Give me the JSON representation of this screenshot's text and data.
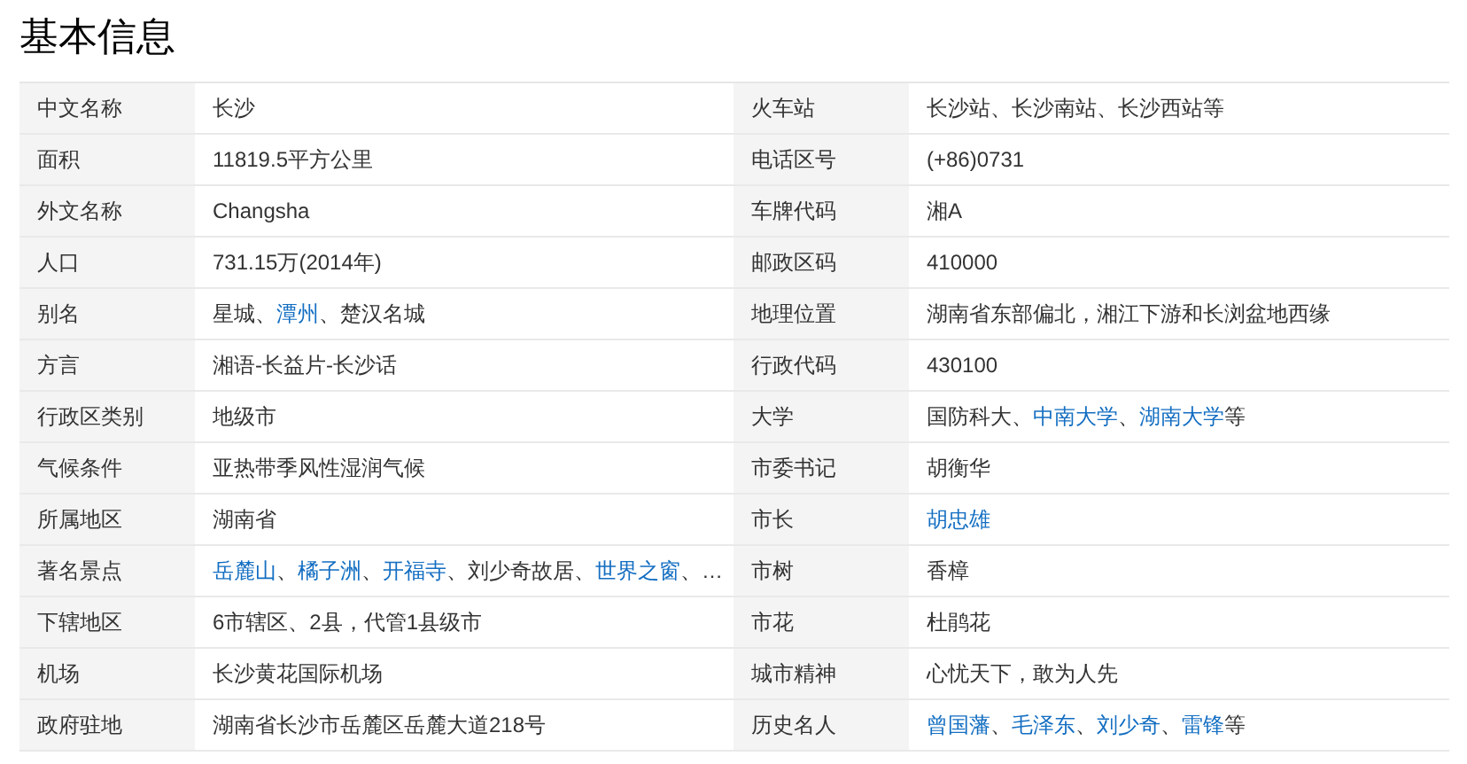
{
  "title": "基本信息",
  "columns": [
    {
      "rows": [
        {
          "label": "中文名称",
          "value": [
            {
              "text": "长沙",
              "link": false
            }
          ]
        },
        {
          "label": "面积",
          "value": [
            {
              "text": "11819.5平方公里",
              "link": false
            }
          ]
        },
        {
          "label": "外文名称",
          "value": [
            {
              "text": "Changsha",
              "link": false
            }
          ]
        },
        {
          "label": "人口",
          "value": [
            {
              "text": "731.15万(2014年)",
              "link": false
            }
          ]
        },
        {
          "label": "别名",
          "value": [
            {
              "text": "星城、",
              "link": false
            },
            {
              "text": "潭州",
              "link": true
            },
            {
              "text": "、楚汉名城",
              "link": false
            }
          ]
        },
        {
          "label": "方言",
          "value": [
            {
              "text": "湘语-长益片-长沙话",
              "link": false
            }
          ]
        },
        {
          "label": "行政区类别",
          "value": [
            {
              "text": "地级市",
              "link": false
            }
          ]
        },
        {
          "label": "气候条件",
          "value": [
            {
              "text": "亚热带季风性湿润气候",
              "link": false
            }
          ]
        },
        {
          "label": "所属地区",
          "value": [
            {
              "text": "湖南省",
              "link": false
            }
          ]
        },
        {
          "label": "著名景点",
          "value": [
            {
              "text": "岳麓山",
              "link": true
            },
            {
              "text": "、",
              "link": false
            },
            {
              "text": "橘子洲",
              "link": true
            },
            {
              "text": "、",
              "link": false
            },
            {
              "text": "开福寺",
              "link": true
            },
            {
              "text": "、刘少奇故居、",
              "link": false
            },
            {
              "text": "世界之窗",
              "link": true
            },
            {
              "text": "、…",
              "link": false
            }
          ]
        },
        {
          "label": "下辖地区",
          "value": [
            {
              "text": "6市辖区、2县，代管1县级市",
              "link": false
            }
          ]
        },
        {
          "label": "机场",
          "value": [
            {
              "text": "长沙黄花国际机场",
              "link": false
            }
          ]
        },
        {
          "label": "政府驻地",
          "value": [
            {
              "text": "湖南省长沙市岳麓区岳麓大道218号",
              "link": false
            }
          ]
        }
      ]
    },
    {
      "rows": [
        {
          "label": "火车站",
          "value": [
            {
              "text": "长沙站、长沙南站、长沙西站等",
              "link": false
            }
          ]
        },
        {
          "label": "电话区号",
          "value": [
            {
              "text": "(+86)0731",
              "link": false
            }
          ]
        },
        {
          "label": "车牌代码",
          "value": [
            {
              "text": "湘A",
              "link": false
            }
          ]
        },
        {
          "label": "邮政区码",
          "value": [
            {
              "text": "410000",
              "link": false
            }
          ]
        },
        {
          "label": "地理位置",
          "value": [
            {
              "text": "湖南省东部偏北，湘江下游和长浏盆地西缘",
              "link": false
            }
          ]
        },
        {
          "label": "行政代码",
          "value": [
            {
              "text": "430100",
              "link": false
            }
          ]
        },
        {
          "label": "大学",
          "value": [
            {
              "text": "国防科大、",
              "link": false
            },
            {
              "text": "中南大学",
              "link": true
            },
            {
              "text": "、",
              "link": false
            },
            {
              "text": "湖南大学",
              "link": true
            },
            {
              "text": "等",
              "link": false
            }
          ]
        },
        {
          "label": "市委书记",
          "value": [
            {
              "text": "胡衡华",
              "link": false
            }
          ]
        },
        {
          "label": "市长",
          "value": [
            {
              "text": "胡忠雄",
              "link": true
            }
          ]
        },
        {
          "label": "市树",
          "value": [
            {
              "text": "香樟",
              "link": false
            }
          ]
        },
        {
          "label": "市花",
          "value": [
            {
              "text": "杜鹃花",
              "link": false
            }
          ]
        },
        {
          "label": "城市精神",
          "value": [
            {
              "text": "心忧天下，敢为人先",
              "link": false
            }
          ]
        },
        {
          "label": "历史名人",
          "value": [
            {
              "text": "曾国藩",
              "link": true
            },
            {
              "text": "、",
              "link": false
            },
            {
              "text": "毛泽东",
              "link": true
            },
            {
              "text": "、",
              "link": false
            },
            {
              "text": "刘少奇",
              "link": true
            },
            {
              "text": "、",
              "link": false
            },
            {
              "text": "雷锋",
              "link": true
            },
            {
              "text": "等",
              "link": false
            }
          ]
        }
      ]
    }
  ]
}
